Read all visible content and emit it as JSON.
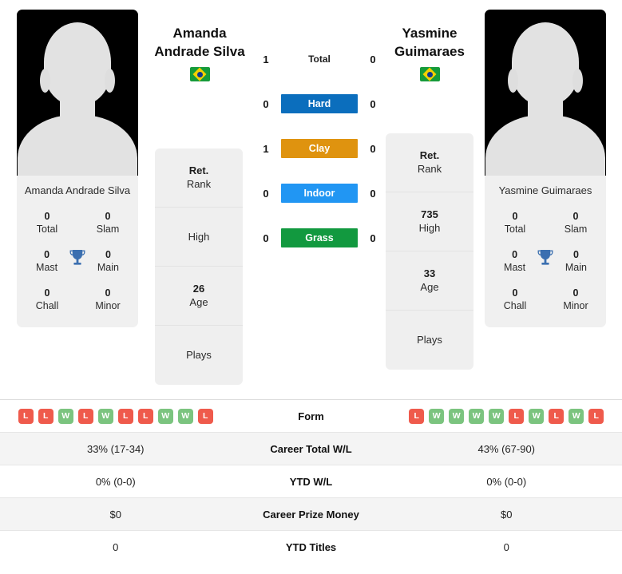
{
  "players": {
    "left": {
      "heading_name": "Amanda\nAndrade Silva",
      "heading_line1": "Amanda",
      "heading_line2": "Andrade Silva",
      "card_name": "Amanda Andrade Silva",
      "country_flag": "brazil-flag",
      "photo": "player-photo-placeholder",
      "trophies": [
        {
          "value": "0",
          "label": "Total"
        },
        {
          "value": "0",
          "label": "Slam"
        },
        {
          "value": "0",
          "label": "Mast"
        },
        {
          "value": "0",
          "label": "Main"
        },
        {
          "value": "0",
          "label": "Chall"
        },
        {
          "value": "0",
          "label": "Minor"
        }
      ],
      "info": [
        {
          "value": "Ret.",
          "label": "Rank"
        },
        {
          "value": "",
          "label": "High"
        },
        {
          "value": "26",
          "label": "Age"
        },
        {
          "value": "",
          "label": "Plays"
        }
      ]
    },
    "right": {
      "heading_name": "Yasmine\nGuimaraes",
      "heading_line1": "Yasmine",
      "heading_line2": "Guimaraes",
      "card_name": "Yasmine Guimaraes",
      "country_flag": "brazil-flag",
      "photo": "player-photo-placeholder",
      "trophies": [
        {
          "value": "0",
          "label": "Total"
        },
        {
          "value": "0",
          "label": "Slam"
        },
        {
          "value": "0",
          "label": "Mast"
        },
        {
          "value": "0",
          "label": "Main"
        },
        {
          "value": "0",
          "label": "Chall"
        },
        {
          "value": "0",
          "label": "Minor"
        }
      ],
      "info": [
        {
          "value": "Ret.",
          "label": "Rank"
        },
        {
          "value": "735",
          "label": "High"
        },
        {
          "value": "33",
          "label": "Age"
        },
        {
          "value": "",
          "label": "Plays"
        }
      ]
    }
  },
  "surfaces": [
    {
      "label": "Total",
      "left": "1",
      "right": "0",
      "color": ""
    },
    {
      "label": "Hard",
      "left": "0",
      "right": "0",
      "color": "#0b6ebd"
    },
    {
      "label": "Clay",
      "left": "1",
      "right": "0",
      "color": "#df930f"
    },
    {
      "label": "Indoor",
      "left": "0",
      "right": "0",
      "color": "#2196f3"
    },
    {
      "label": "Grass",
      "left": "0",
      "right": "0",
      "color": "#12993f"
    }
  ],
  "stats": [
    {
      "label": "Form",
      "type": "form",
      "left_form": [
        "L",
        "L",
        "W",
        "L",
        "W",
        "L",
        "L",
        "W",
        "W",
        "L"
      ],
      "right_form": [
        "L",
        "W",
        "W",
        "W",
        "W",
        "L",
        "W",
        "L",
        "W",
        "L"
      ],
      "left": "",
      "right": ""
    },
    {
      "label": "Career Total W/L",
      "type": "text",
      "left": "33% (17-34)",
      "right": "43% (67-90)"
    },
    {
      "label": "YTD W/L",
      "type": "text",
      "left": "0% (0-0)",
      "right": "0% (0-0)"
    },
    {
      "label": "Career Prize Money",
      "type": "text",
      "left": "$0",
      "right": "$0"
    },
    {
      "label": "YTD Titles",
      "type": "text",
      "left": "0",
      "right": "0"
    }
  ],
  "colors": {
    "win": "#7bc47f",
    "loss": "#ef5a4c",
    "hard": "#0b6ebd",
    "clay": "#df930f",
    "indoor": "#2196f3",
    "grass": "#12993f",
    "trophy": "#3b6fb0",
    "card_bg": "#f0f0f0"
  }
}
